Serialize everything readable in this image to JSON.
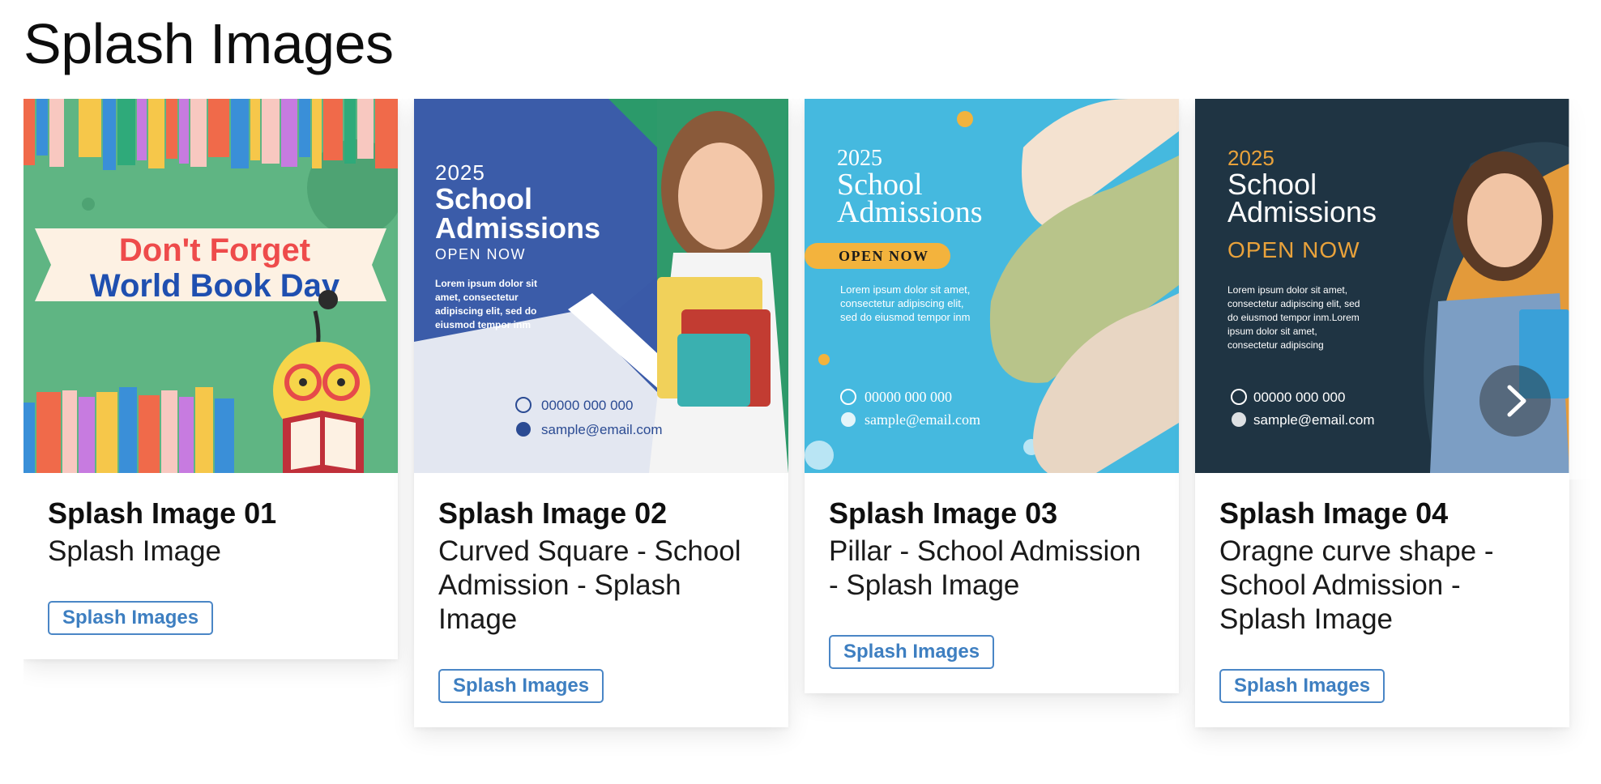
{
  "page": {
    "title": "Splash Images"
  },
  "cards": [
    {
      "title": "Splash Image 01",
      "subtitle": "Splash Image",
      "tag": "Splash Images",
      "art": {
        "line1": "Don't Forget",
        "line2": "World Book Day"
      }
    },
    {
      "title": "Splash Image 02",
      "subtitle": "Curved Square - School Admission - Splash Image",
      "tag": "Splash Images",
      "art": {
        "year": "2025",
        "heading1": "School",
        "heading2": "Admissions",
        "open": "OPEN NOW",
        "body": [
          "Lorem ipsum dolor sit",
          "amet, consectetur",
          "adipiscing elit, sed do",
          "eiusmod tempor inm"
        ],
        "phone": "00000 000 000",
        "email": "sample@email.com"
      }
    },
    {
      "title": "Splash Image 03",
      "subtitle": "Pillar - School Admission - Splash Image",
      "tag": "Splash Images",
      "art": {
        "year": "2025",
        "heading1": "School",
        "heading2": "Admissions",
        "open": "OPEN NOW",
        "body": [
          "Lorem ipsum dolor sit amet,",
          "consectetur adipiscing elit,",
          "sed do eiusmod tempor inm"
        ],
        "phone": "00000 000 000",
        "email": "sample@email.com"
      }
    },
    {
      "title": "Splash Image 04",
      "subtitle": "Oragne curve shape - School Admission - Splash Image",
      "tag": "Splash Images",
      "art": {
        "year": "2025",
        "heading1": "School",
        "heading2": "Admissions",
        "open": "OPEN NOW",
        "body": [
          "Lorem ipsum dolor sit amet,",
          "consectetur adipiscing elit, sed",
          "do eiusmod tempor inm.Lorem",
          "ipsum dolor sit amet,",
          "consectetur adipiscing"
        ],
        "phone": "00000 000 000",
        "email": "sample@email.com"
      }
    }
  ],
  "carousel": {
    "next_icon": "chevron-right-icon"
  }
}
